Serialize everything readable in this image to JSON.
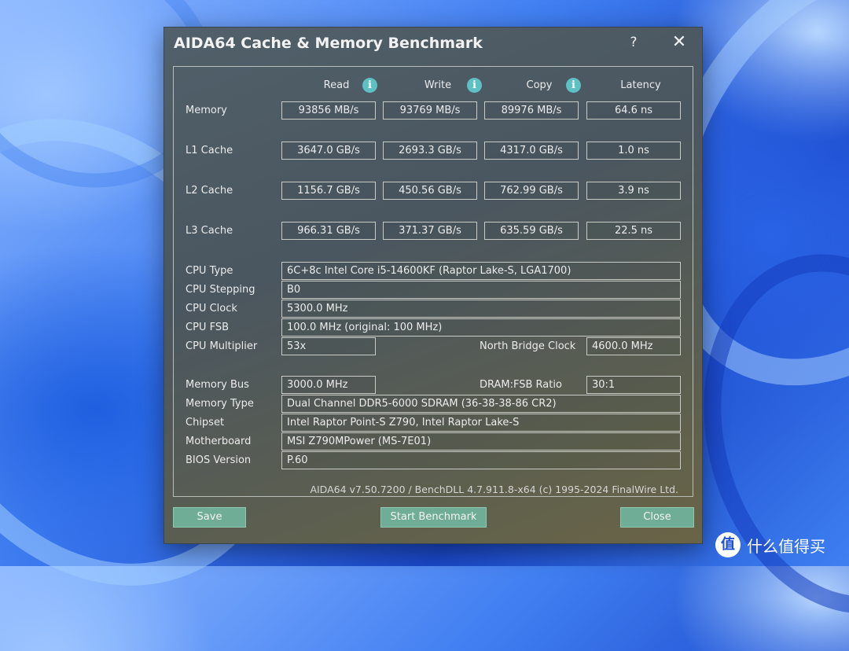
{
  "window": {
    "title": "AIDA64 Cache & Memory Benchmark",
    "help_glyph": "?",
    "close_glyph": "✕"
  },
  "columns": {
    "read": "Read",
    "write": "Write",
    "copy": "Copy",
    "latency": "Latency",
    "info_glyph": "i"
  },
  "rows": [
    {
      "label": "Memory",
      "read": "93856 MB/s",
      "write": "93769 MB/s",
      "copy": "89976 MB/s",
      "latency": "64.6 ns"
    },
    {
      "label": "L1 Cache",
      "read": "3647.0 GB/s",
      "write": "2693.3 GB/s",
      "copy": "4317.0 GB/s",
      "latency": "1.0 ns"
    },
    {
      "label": "L2 Cache",
      "read": "1156.7 GB/s",
      "write": "450.56 GB/s",
      "copy": "762.99 GB/s",
      "latency": "3.9 ns"
    },
    {
      "label": "L3 Cache",
      "read": "966.31 GB/s",
      "write": "371.37 GB/s",
      "copy": "635.59 GB/s",
      "latency": "22.5 ns"
    }
  ],
  "cpu": {
    "type_label": "CPU Type",
    "type_value": "6C+8c Intel Core i5-14600KF  (Raptor Lake-S, LGA1700)",
    "stepping_label": "CPU Stepping",
    "stepping_value": "B0",
    "clock_label": "CPU Clock",
    "clock_value": "5300.0 MHz",
    "fsb_label": "CPU FSB",
    "fsb_value": "100.0 MHz  (original: 100 MHz)",
    "multiplier_label": "CPU Multiplier",
    "multiplier_value": "53x",
    "nb_clock_label": "North Bridge Clock",
    "nb_clock_value": "4600.0 MHz"
  },
  "memory": {
    "bus_label": "Memory Bus",
    "bus_value": "3000.0 MHz",
    "ratio_label": "DRAM:FSB Ratio",
    "ratio_value": "30:1",
    "type_label": "Memory Type",
    "type_value": "Dual Channel DDR5-6000 SDRAM  (36-38-38-86 CR2)",
    "chipset_label": "Chipset",
    "chipset_value": "Intel Raptor Point-S Z790, Intel Raptor Lake-S",
    "motherboard_label": "Motherboard",
    "motherboard_value": "MSI Z790MPower (MS-7E01)",
    "bios_label": "BIOS Version",
    "bios_value": "P.60"
  },
  "footer": "AIDA64 v7.50.7200 / BenchDLL 4.7.911.8-x64  (c) 1995-2024 FinalWire Ltd.",
  "buttons": {
    "save": "Save",
    "start": "Start Benchmark",
    "close": "Close"
  },
  "watermark": {
    "logo": "值",
    "text": "什么值得买"
  }
}
